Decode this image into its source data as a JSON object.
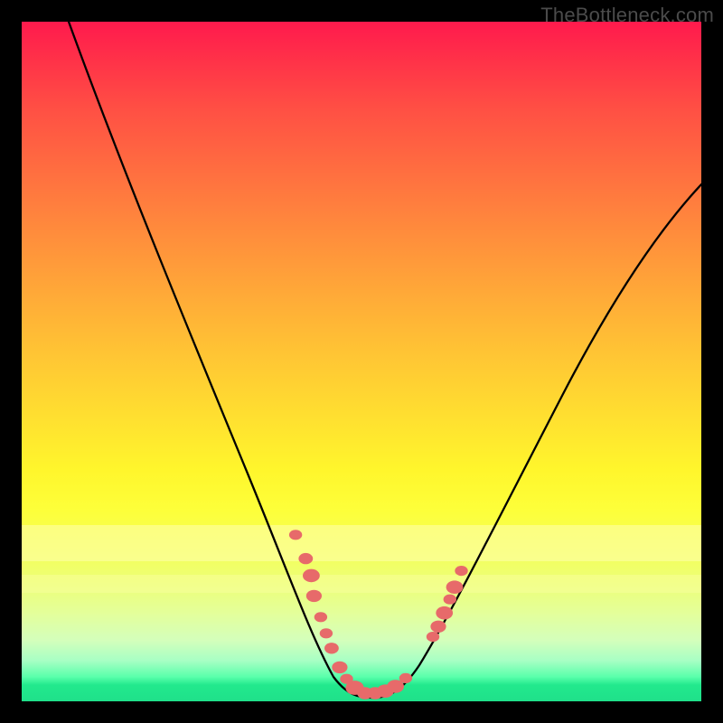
{
  "watermark": "TheBottleneck.com",
  "colors": {
    "dot": "#e76a6a",
    "curve": "#000000",
    "background_top": "#ff1a4d",
    "background_bottom": "#1fe08a"
  },
  "chart_data": {
    "type": "line",
    "title": "",
    "xlabel": "",
    "ylabel": "",
    "xlim": [
      0,
      100
    ],
    "ylim": [
      0,
      100
    ],
    "grid": false,
    "series": [
      {
        "name": "bottleneck-curve",
        "x": [
          7,
          12,
          18,
          24,
          30,
          36,
          40,
          43,
          46,
          48,
          50,
          52,
          54,
          56,
          60,
          65,
          72,
          80,
          90,
          100
        ],
        "y": [
          100,
          85,
          70,
          56,
          42,
          30,
          21,
          14,
          8,
          4,
          1.5,
          1,
          1.5,
          3,
          8,
          17,
          31,
          47,
          64,
          76
        ]
      }
    ],
    "markers": [
      {
        "x": 40.3,
        "y": 24.5,
        "r": 1.0
      },
      {
        "x": 41.8,
        "y": 21.0,
        "r": 1.1
      },
      {
        "x": 42.6,
        "y": 18.5,
        "r": 1.3
      },
      {
        "x": 43.0,
        "y": 15.5,
        "r": 1.2
      },
      {
        "x": 44.0,
        "y": 12.4,
        "r": 1.0
      },
      {
        "x": 44.8,
        "y": 10.0,
        "r": 1.0
      },
      {
        "x": 45.6,
        "y": 7.8,
        "r": 1.1
      },
      {
        "x": 46.8,
        "y": 5.0,
        "r": 1.2
      },
      {
        "x": 47.8,
        "y": 3.3,
        "r": 1.0
      },
      {
        "x": 49.0,
        "y": 2.0,
        "r": 1.4
      },
      {
        "x": 50.5,
        "y": 1.2,
        "r": 1.2
      },
      {
        "x": 52.0,
        "y": 1.2,
        "r": 1.2
      },
      {
        "x": 53.5,
        "y": 1.5,
        "r": 1.3
      },
      {
        "x": 55.0,
        "y": 2.2,
        "r": 1.3
      },
      {
        "x": 56.5,
        "y": 3.4,
        "r": 1.0
      },
      {
        "x": 60.5,
        "y": 9.5,
        "r": 1.0
      },
      {
        "x": 61.3,
        "y": 11.0,
        "r": 1.2
      },
      {
        "x": 62.2,
        "y": 13.0,
        "r": 1.3
      },
      {
        "x": 63.0,
        "y": 15.0,
        "r": 1.0
      },
      {
        "x": 63.7,
        "y": 16.8,
        "r": 1.3
      },
      {
        "x": 64.7,
        "y": 19.2,
        "r": 1.0
      }
    ],
    "annotations": []
  }
}
